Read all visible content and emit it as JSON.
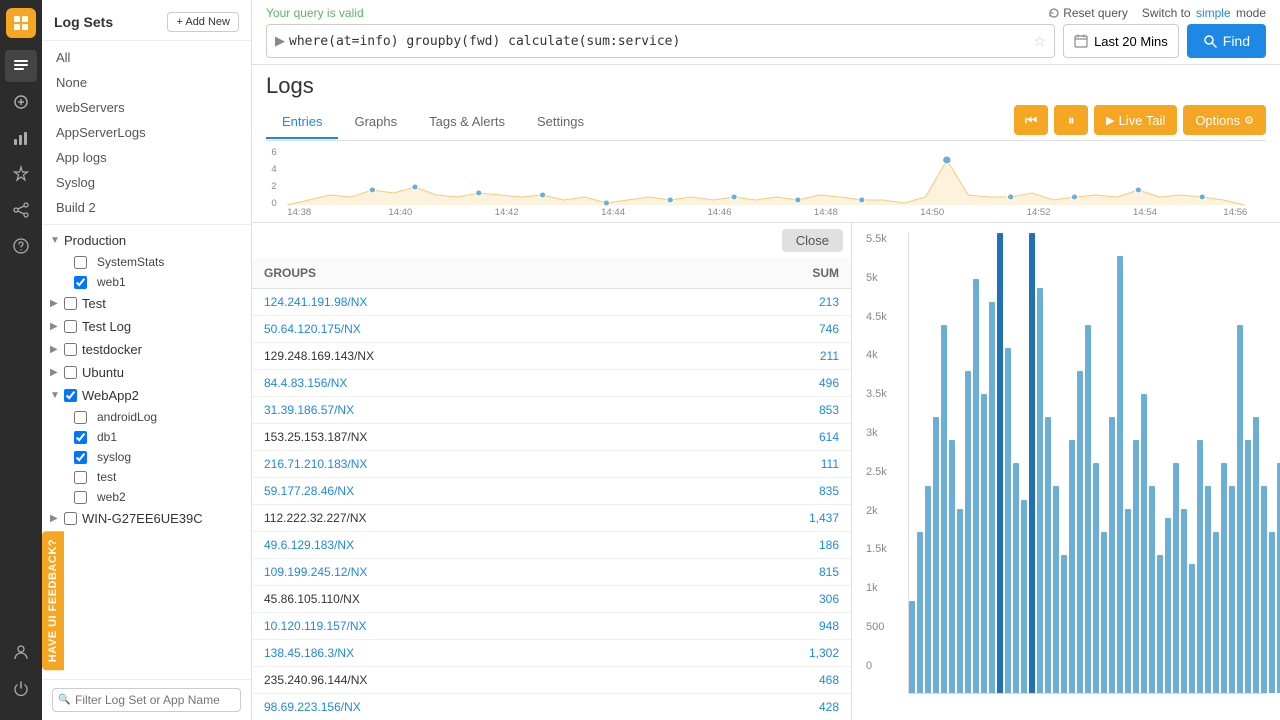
{
  "app": {
    "title": "Log Sets"
  },
  "topbar": {
    "query_valid": "Your query is valid",
    "query": "where(at=info) groupby(fwd) calculate(sum:service)",
    "time_range": "Last 20 Mins",
    "find_label": "Find",
    "reset_query": "Reset query",
    "switch_text": "Switch to",
    "simple_text": "simple",
    "mode_text": "mode"
  },
  "logs": {
    "title": "Logs",
    "tabs": [
      "Entries",
      "Graphs",
      "Tags & Alerts",
      "Settings"
    ],
    "active_tab": 0
  },
  "controls": {
    "live_tail": "Live Tail",
    "options": "Options"
  },
  "sidebar": {
    "title": "Log Sets",
    "add_new": "+ Add New",
    "nav_items": [
      "All",
      "None",
      "webServers",
      "AppServerLogs",
      "App logs",
      "Syslog",
      "Build 2"
    ],
    "search_placeholder": "Filter Log Set or App Name",
    "tree": [
      {
        "label": "Production",
        "expanded": true,
        "children": [
          {
            "label": "SystemStats",
            "checked": false
          },
          {
            "label": "web1",
            "checked": true
          }
        ]
      },
      {
        "label": "Test",
        "expanded": false,
        "children": []
      },
      {
        "label": "Test Log",
        "expanded": false,
        "children": []
      },
      {
        "label": "testdocker",
        "expanded": false,
        "children": []
      },
      {
        "label": "Ubuntu",
        "expanded": false,
        "children": []
      },
      {
        "label": "WebApp2",
        "expanded": true,
        "children": [
          {
            "label": "androidLog",
            "checked": false
          },
          {
            "label": "db1",
            "checked": true
          },
          {
            "label": "syslog",
            "checked": true
          },
          {
            "label": "test",
            "checked": false
          },
          {
            "label": "web2",
            "checked": false
          }
        ]
      },
      {
        "label": "WIN-G27EE6UE39C",
        "expanded": false,
        "children": []
      }
    ]
  },
  "table": {
    "col_groups": "GROUPS",
    "col_sum": "SUM",
    "close_label": "Close",
    "rows": [
      {
        "group": "124.241.191.98/NX",
        "sum": "213"
      },
      {
        "group": "50.64.120.175/NX",
        "sum": "746"
      },
      {
        "group": "129.248.169.143/NX",
        "sum": "211"
      },
      {
        "group": "84.4.83.156/NX",
        "sum": "496"
      },
      {
        "group": "31.39.186.57/NX",
        "sum": "853"
      },
      {
        "group": "153.25.153.187/NX",
        "sum": "614"
      },
      {
        "group": "216.71.210.183/NX",
        "sum": "111"
      },
      {
        "group": "59.177.28.46/NX",
        "sum": "835"
      },
      {
        "group": "112.222.32.227/NX",
        "sum": "1,437"
      },
      {
        "group": "49.6.129.183/NX",
        "sum": "186"
      },
      {
        "group": "109.199.245.12/NX",
        "sum": "815"
      },
      {
        "group": "45.86.105.110/NX",
        "sum": "306"
      },
      {
        "group": "10.120.119.157/NX",
        "sum": "948"
      },
      {
        "group": "138.45.186.3/NX",
        "sum": "1,302"
      },
      {
        "group": "235.240.96.144/NX",
        "sum": "468"
      },
      {
        "group": "98.69.223.156/NX",
        "sum": "428"
      }
    ]
  },
  "barchart": {
    "y_labels": [
      "5.5k",
      "5k",
      "4.5k",
      "4k",
      "3.5k",
      "3k",
      "2.5k",
      "2k",
      "1.5k",
      "1k",
      "500",
      "0"
    ],
    "bars": [
      20,
      35,
      45,
      60,
      80,
      55,
      40,
      70,
      90,
      65,
      85,
      100,
      75,
      50,
      42,
      100,
      88,
      60,
      45,
      30,
      55,
      70,
      80,
      50,
      35,
      60,
      95,
      40,
      55,
      65,
      45,
      30,
      38,
      50,
      40,
      28,
      55,
      45,
      35,
      50,
      45,
      80,
      55,
      60,
      45,
      35,
      50,
      40,
      55,
      45
    ]
  },
  "mini_chart": {
    "x_labels": [
      "14:38",
      "14:40",
      "14:42",
      "14:44",
      "14:46",
      "14:48",
      "14:50",
      "14:52",
      "14:54",
      "14:56"
    ],
    "y_max": 6,
    "y_labels": [
      "6",
      "4",
      "2",
      "0"
    ]
  },
  "feedback": {
    "label": "HAVE UI FEEDBACK?"
  }
}
